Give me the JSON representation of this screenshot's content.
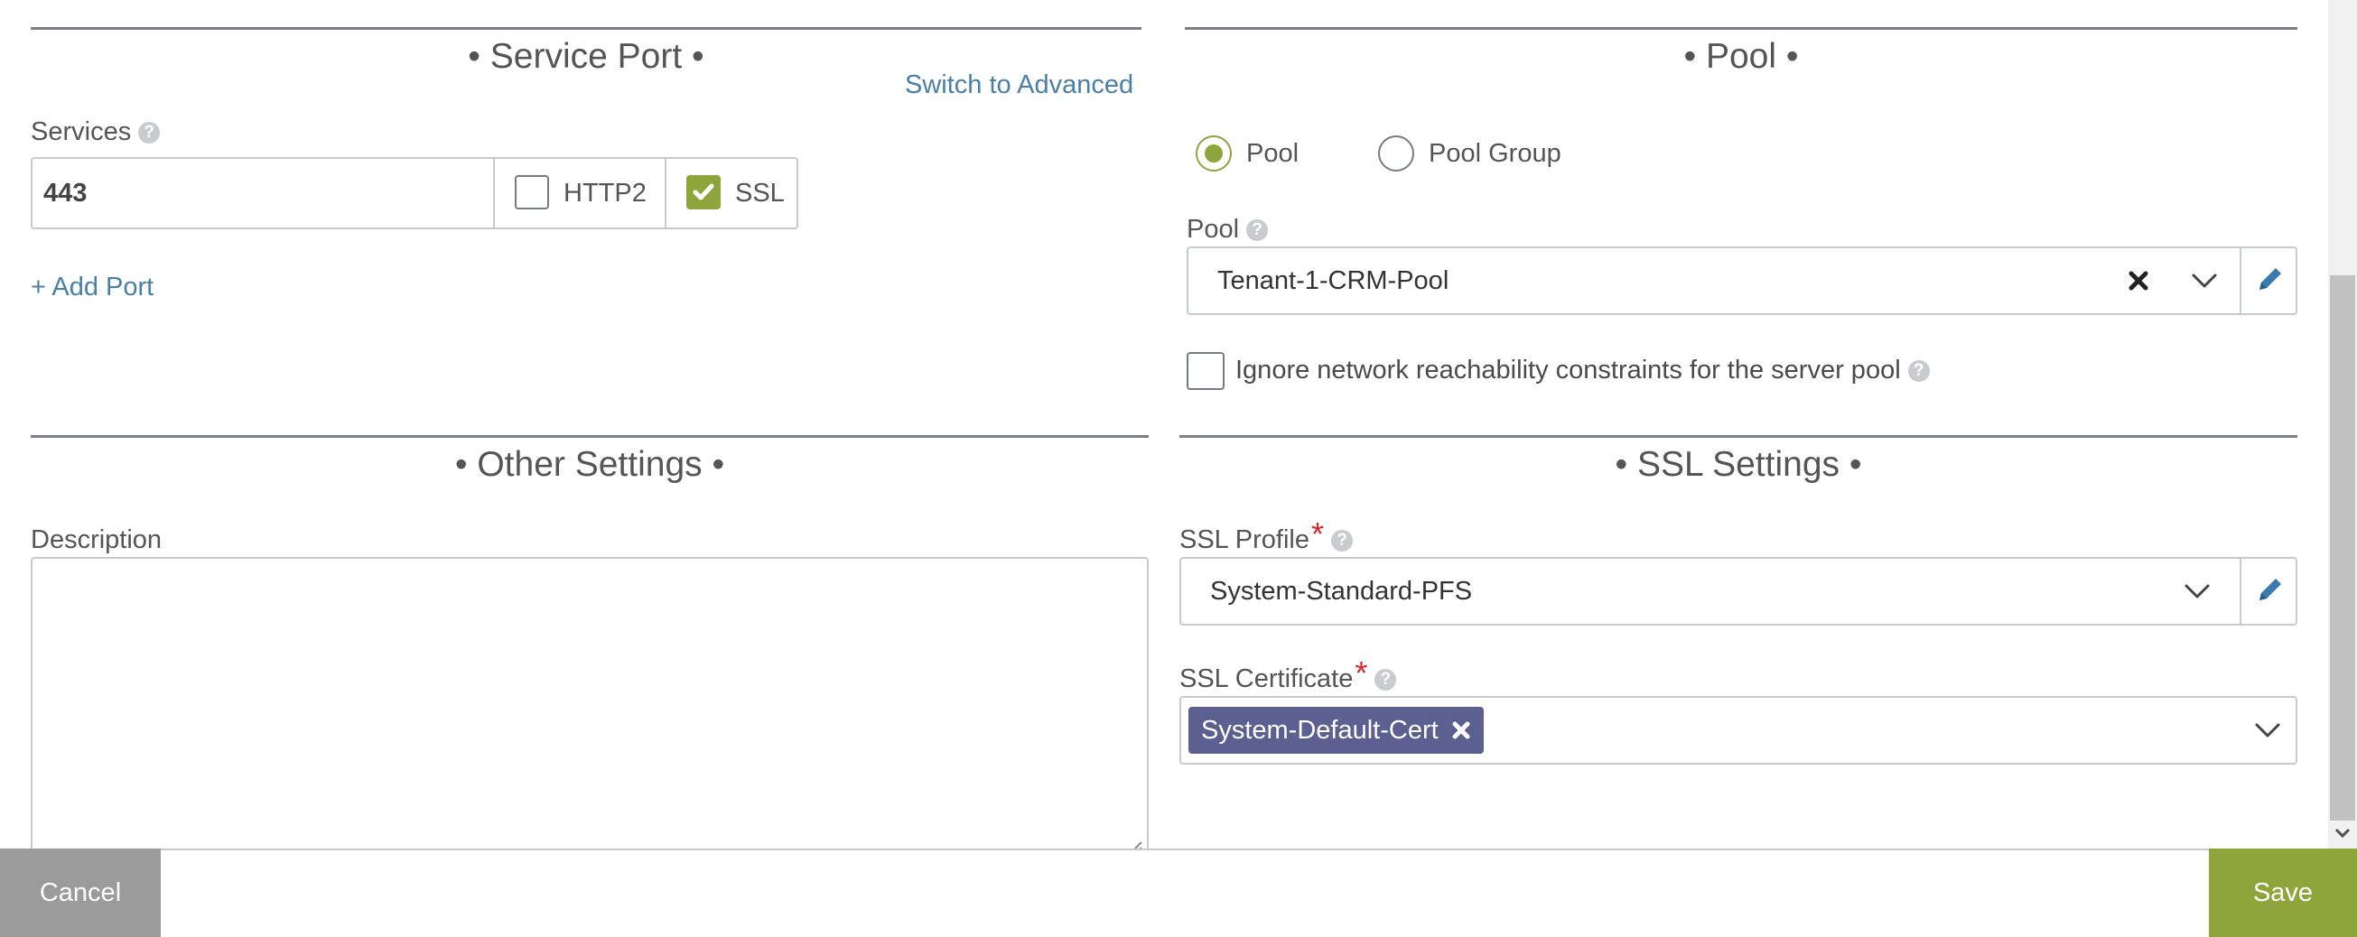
{
  "service_port": {
    "title": "• Service Port •",
    "switch_link": "Switch to Advanced",
    "services_label": "Services",
    "port_value": "443",
    "http2_label": "HTTP2",
    "http2_checked": false,
    "ssl_label": "SSL",
    "ssl_checked": true,
    "add_port": "+ Add Port"
  },
  "pool": {
    "title": "• Pool •",
    "radio_pool": "Pool",
    "radio_pool_group": "Pool Group",
    "selected": "Pool",
    "pool_label": "Pool",
    "pool_value": "Tenant-1-CRM-Pool",
    "ignore_label": "Ignore network reachability constraints for the server pool",
    "ignore_checked": false
  },
  "other_settings": {
    "title": "• Other Settings •",
    "description_label": "Description",
    "description_value": ""
  },
  "ssl_settings": {
    "title": "• SSL Settings •",
    "profile_label": "SSL Profile",
    "profile_value": "System-Standard-PFS",
    "certificate_label": "SSL Certificate",
    "certificate_tag": "System-Default-Cert"
  },
  "footer": {
    "cancel": "Cancel",
    "save": "Save"
  },
  "colors": {
    "accent_green": "#8ea53b",
    "link_blue": "#4a7fa8",
    "tag_purple": "#5b6090",
    "cancel_gray": "#9b9b9b",
    "required_red": "#d9262c"
  },
  "icons": [
    "help-icon",
    "checkmark-icon",
    "clear-icon",
    "chevron-down-icon",
    "pencil-icon",
    "remove-tag-icon",
    "resize-grip-icon",
    "scroll-down-icon"
  ]
}
